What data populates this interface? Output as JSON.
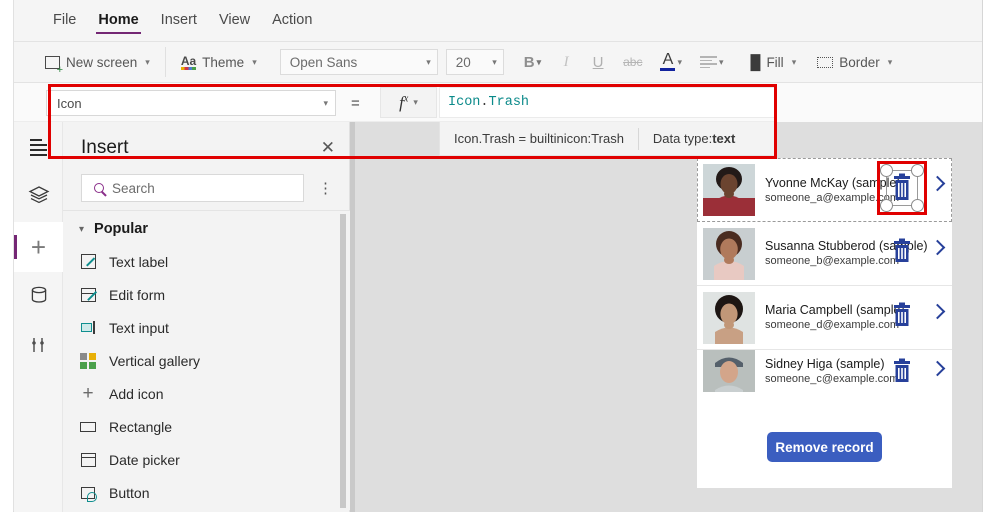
{
  "menu": {
    "items": [
      {
        "label": "File",
        "active": false
      },
      {
        "label": "Home",
        "active": true
      },
      {
        "label": "Insert",
        "active": false
      },
      {
        "label": "View",
        "active": false
      },
      {
        "label": "Action",
        "active": false
      }
    ]
  },
  "ribbon": {
    "new_screen": "New screen",
    "theme": "Theme",
    "font_family": "Open Sans",
    "font_size": "20",
    "bold": "B",
    "italic": "I",
    "underline": "U",
    "strikethrough": "abc",
    "font_color": "A",
    "align": "align",
    "fill": "Fill",
    "border": "Border"
  },
  "formula_bar": {
    "property": "Icon",
    "equals": "=",
    "fx": "fx",
    "value_object": "Icon",
    "value_dot": ".",
    "value_prop": "Trash",
    "tooltip_expression": "Icon.Trash  =  builtinicon:Trash",
    "tooltip_datatype_label": "Data type: ",
    "tooltip_datatype_value": "text"
  },
  "rail": {
    "items": [
      {
        "name": "menu",
        "label": "Menu",
        "selected": false
      },
      {
        "name": "tree-view",
        "label": "Tree view",
        "selected": false
      },
      {
        "name": "insert",
        "label": "Insert",
        "selected": true
      },
      {
        "name": "data",
        "label": "Data",
        "selected": false
      },
      {
        "name": "tools",
        "label": "Tools",
        "selected": false
      }
    ]
  },
  "insert_panel": {
    "title": "Insert",
    "close": "✕",
    "search_placeholder": "Search",
    "more": "⋮",
    "group_label": "Popular",
    "group_chevron": "⌄",
    "items": [
      {
        "label": "Text label",
        "icon": "text-label-icon"
      },
      {
        "label": "Edit form",
        "icon": "edit-form-icon"
      },
      {
        "label": "Text input",
        "icon": "text-input-icon"
      },
      {
        "label": "Vertical gallery",
        "icon": "vertical-gallery-icon"
      },
      {
        "label": "Add icon",
        "icon": "add-icon"
      },
      {
        "label": "Rectangle",
        "icon": "rectangle-icon"
      },
      {
        "label": "Date picker",
        "icon": "date-picker-icon"
      },
      {
        "label": "Button",
        "icon": "button-icon"
      }
    ]
  },
  "canvas": {
    "gallery": [
      {
        "name": "Yvonne McKay (sample)",
        "email": "someone_a@example.com",
        "selected": true
      },
      {
        "name": "Susanna Stubberod (sample)",
        "email": "someone_b@example.com",
        "selected": false
      },
      {
        "name": "Maria Campbell (sample)",
        "email": "someone_d@example.com",
        "selected": false
      },
      {
        "name": "Sidney Higa (sample)",
        "email": "someone_c@example.com",
        "selected": false
      }
    ],
    "remove_button": "Remove record"
  },
  "colors": {
    "accent": "#742774",
    "highlight": "#e00000",
    "button_blue": "#3b5ec0",
    "icon_blue": "#27409a",
    "formula_token": "#0b8a8a"
  }
}
